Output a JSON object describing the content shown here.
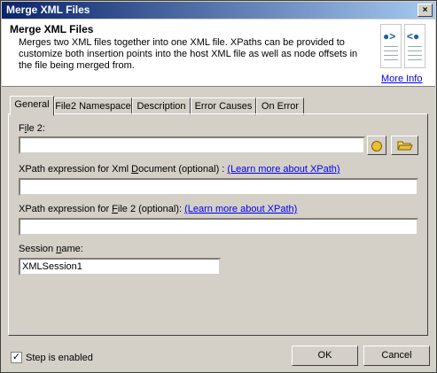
{
  "window": {
    "title": "Merge XML Files",
    "close_glyph": "×"
  },
  "header": {
    "title": "Merge XML Files",
    "description": "Merges two XML files together into one XML file.  XPaths can be provided to customize both insertion points into the host XML file as well as node offsets in the file being merged from.",
    "more_info": "More Info",
    "icon_left_symbol": "●>",
    "icon_right_symbol": "<●"
  },
  "tabs": [
    {
      "label": "General",
      "active": true
    },
    {
      "label": "File2 Namespace"
    },
    {
      "label": "Description"
    },
    {
      "label": "Error Causes"
    },
    {
      "label": "On Error"
    }
  ],
  "general": {
    "file2": {
      "label_pre": "F",
      "label_u": "i",
      "label_post": "le 2:",
      "value": ""
    },
    "xpath_doc": {
      "label_pre": "XPath expression for Xml ",
      "label_u": "D",
      "label_post": "ocument (optional) : ",
      "link": "(Learn more about XPath)",
      "value": ""
    },
    "xpath_file2": {
      "label_pre": "XPath expression for ",
      "label_u": "F",
      "label_post": "ile 2 (optional): ",
      "link": "(Learn more about XPath)",
      "value": ""
    },
    "session": {
      "label_pre": "Session ",
      "label_u": "n",
      "label_post": "ame:",
      "value": "XMLSession1"
    }
  },
  "footer": {
    "step_enabled_label": "Step is enabled",
    "step_enabled_checked": true,
    "check_glyph": "✓",
    "ok": "OK",
    "cancel": "Cancel"
  }
}
